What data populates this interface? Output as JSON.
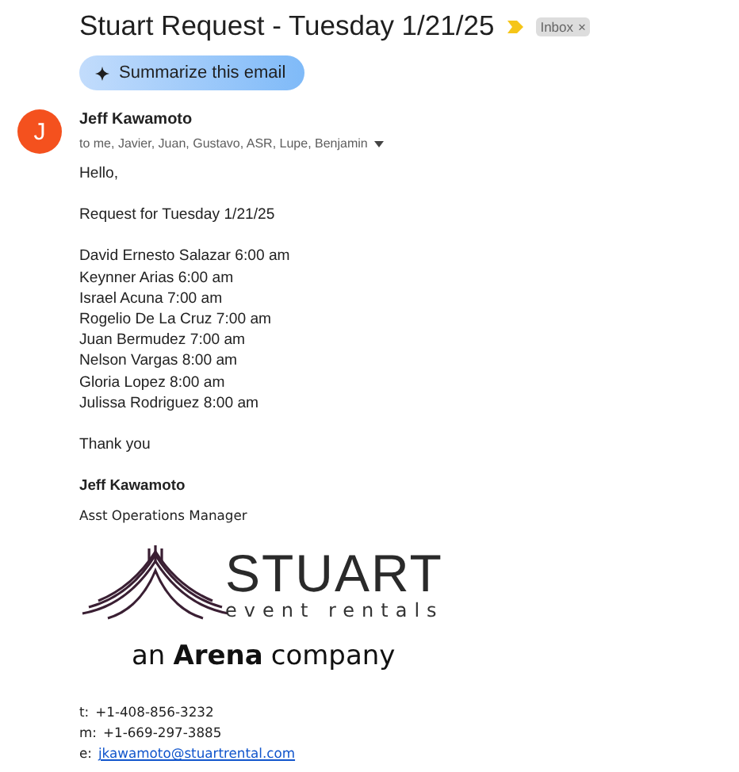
{
  "subject": "Stuart Request - Tuesday 1/21/25",
  "label_chip": {
    "text": "Inbox",
    "close": "×"
  },
  "summarize_button": "Summarize this email",
  "sender": {
    "avatar": "J",
    "name": "Jeff Kawamoto",
    "recipients": "to me, Javier, Juan, Gustavo, ASR, Lupe, Benjamin"
  },
  "body": {
    "greeting": "Hello,",
    "intro": "Request for Tuesday 1/21/25",
    "schedule": [
      "David Ernesto Salazar 6:00 am",
      "Keynner Arias 6:00 am",
      "Israel Acuna 7:00 am",
      "Rogelio De La Cruz 7:00 am",
      "Juan Bermudez 7:00 am",
      "Nelson Vargas 8:00 am",
      "Gloria Lopez 8:00 am",
      "Julissa Rodriguez 8:00 am"
    ],
    "closing": "Thank you"
  },
  "signature": {
    "name": "Jeff Kawamoto",
    "title": "Asst Operations Manager",
    "logo": {
      "brand": "STUART",
      "tagline": "event rentals",
      "parent_prefix": "an",
      "parent": "Arena",
      "parent_suffix": "company"
    },
    "contacts": [
      {
        "label": "t:",
        "value": "+1-408-856-3232",
        "kind": "text"
      },
      {
        "label": "m:",
        "value": "+1-669-297-3885",
        "kind": "text"
      },
      {
        "label": "e:",
        "value": "jkawamoto@stuartrental.com",
        "kind": "link"
      }
    ]
  }
}
